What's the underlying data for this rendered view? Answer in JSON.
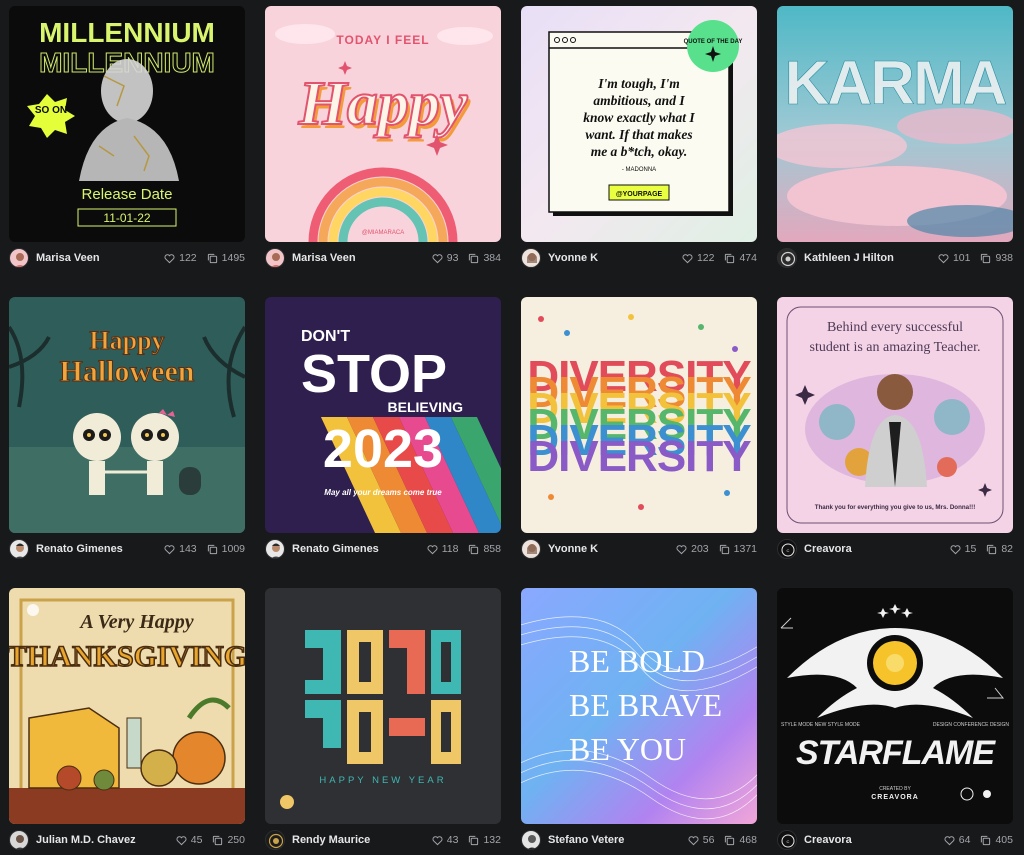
{
  "cards": [
    {
      "author": "Marisa Veen",
      "likes": "122",
      "uses": "1495",
      "img": {
        "title": "MILLENNIUM",
        "title_ghost": "MILLENNIUM",
        "badge": "SO ON",
        "subtitle": "Release Date",
        "date": "11-01-22"
      }
    },
    {
      "author": "Marisa Veen",
      "likes": "93",
      "uses": "384",
      "img": {
        "kicker": "TODAY I FEEL",
        "title": "Happy",
        "handle": "@MIAMARACA"
      }
    },
    {
      "author": "Yvonne K",
      "likes": "122",
      "uses": "474",
      "img": {
        "badge": "QUOTE OF THE DAY",
        "quote_lines": [
          "I'm tough, I'm",
          "ambitious, and I",
          "know exactly what I",
          "want. If that makes",
          "me a b*tch, okay."
        ],
        "attribution": "- MADONNA",
        "button": "@YOURPAGE"
      }
    },
    {
      "author": "Kathleen J Hilton",
      "likes": "101",
      "uses": "938",
      "img": {
        "title": "KARMA"
      }
    },
    {
      "author": "Renato Gimenes",
      "likes": "143",
      "uses": "1009",
      "img": {
        "line1": "Happy",
        "line2": "Halloween"
      }
    },
    {
      "author": "Renato Gimenes",
      "likes": "118",
      "uses": "858",
      "img": {
        "line1": "DON'T",
        "line2": "STOP",
        "line3": "BELIEVING",
        "line4": "2023",
        "tagline": "May all your dreams come true"
      }
    },
    {
      "author": "Yvonne K",
      "likes": "203",
      "uses": "1371",
      "img": {
        "title": "DIVERSITY"
      }
    },
    {
      "author": "Creavora",
      "likes": "15",
      "uses": "82",
      "img": {
        "line1": "Behind every successful",
        "line2": "student is an amazing Teacher.",
        "footer": "Thank you for everything you give to us, Mrs. Donna!!!"
      }
    },
    {
      "author": "Julian M.D. Chavez",
      "likes": "45",
      "uses": "250",
      "img": {
        "line1": "A Very Happy",
        "line2": "THANKSGIVING"
      }
    },
    {
      "author": "Rendy Maurice",
      "likes": "43",
      "uses": "132",
      "img": {
        "caption": "HAPPY NEW YEAR"
      }
    },
    {
      "author": "Stefano Vetere",
      "likes": "56",
      "uses": "468",
      "img": {
        "line1": "BE BOLD",
        "line2": "BE BRAVE",
        "line3": "BE YOU"
      }
    },
    {
      "author": "Creavora",
      "likes": "64",
      "uses": "405",
      "img": {
        "title": "STARFLAME",
        "ticker": "STYLE MODE   NEW STYLE MODE",
        "ticker2": "DESIGN CONFERENCE DESIGN",
        "credit_top": "CREATED BY",
        "credit": "CREAVORA"
      }
    }
  ],
  "colors": {
    "background": "#18191b",
    "stat_text": "#a3a5aa",
    "author_text": "#e6e6e8"
  },
  "icons": {
    "likes": "heart-icon",
    "uses": "copy-icon"
  }
}
